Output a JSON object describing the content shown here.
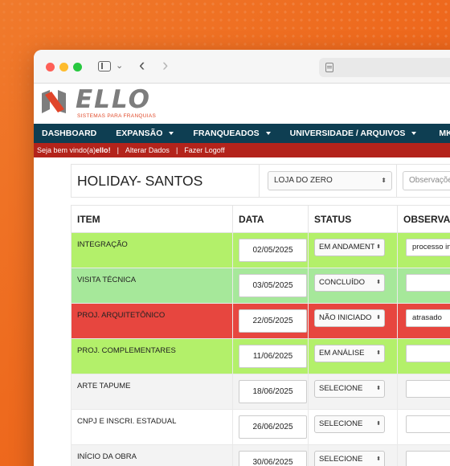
{
  "brand": {
    "name": "ELLO",
    "subtitle": "SISTEMAS PARA FRANQUIAS",
    "colors": {
      "orange": "#ee6a1e",
      "nav": "#0e3e52",
      "userbar": "#b3231b",
      "green": "#b3f06a",
      "light_green": "#a6e89a",
      "red": "#e7463f",
      "gray": "#f3f3f3"
    }
  },
  "browser": {
    "icons": [
      "close-light",
      "minimize-light",
      "zoom-light",
      "sidebar-icon",
      "chevron-down-icon",
      "back-icon",
      "forward-icon",
      "page-icon"
    ]
  },
  "nav": {
    "items": [
      {
        "label": "DASHBOARD",
        "dropdown": false
      },
      {
        "label": "EXPANSÃO",
        "dropdown": true
      },
      {
        "label": "FRANQUEADOS",
        "dropdown": true
      },
      {
        "label": "UNIVERSIDADE / ARQUIVOS",
        "dropdown": true
      },
      {
        "label": "MKT / CO",
        "dropdown": false
      }
    ]
  },
  "userbar": {
    "welcome": "Seja bem vindo(a) ",
    "username": "ello",
    "suffix": "!",
    "alterar": "Alterar Dados",
    "logoff": "Fazer Logoff"
  },
  "project": {
    "title": "HOLIDAY- SANTOS",
    "loja_select": "LOJA DO ZERO",
    "obs_placeholder": "Observações"
  },
  "table": {
    "headers": [
      "ITEM",
      "DATA",
      "STATUS",
      "OBSERVAÇ"
    ],
    "rows": [
      {
        "item": "INTEGRAÇÃO",
        "date": "02/05/2025",
        "status": "EM ANDAMENTO",
        "obs": "processo in",
        "color": "#b3f06a"
      },
      {
        "item": "VISITA TÉCNICA",
        "date": "03/05/2025",
        "status": "CONCLUÍDO",
        "obs": "",
        "color": "#a6e89a"
      },
      {
        "item": "PROJ. ARQUITETÔNICO",
        "date": "22/05/2025",
        "status": "NÃO INICIADO",
        "obs": "atrasado",
        "color": "#e7463f"
      },
      {
        "item": "PROJ. COMPLEMENTARES",
        "date": "11/06/2025",
        "status": "EM ANÁLISE",
        "obs": "",
        "color": "#b3f06a"
      },
      {
        "item": "ARTE TAPUME",
        "date": "18/06/2025",
        "status": "SELECIONE",
        "obs": "",
        "color": "#f3f3f3"
      },
      {
        "item": "CNPJ E INSCRI. ESTADUAL",
        "date": "26/06/2025",
        "status": "SELECIONE",
        "obs": "",
        "color": "#ffffff"
      },
      {
        "item": "INÍCIO DA OBRA",
        "date": "30/06/2025",
        "status": "SELECIONE",
        "obs": "",
        "color": "#f3f3f3"
      }
    ]
  }
}
